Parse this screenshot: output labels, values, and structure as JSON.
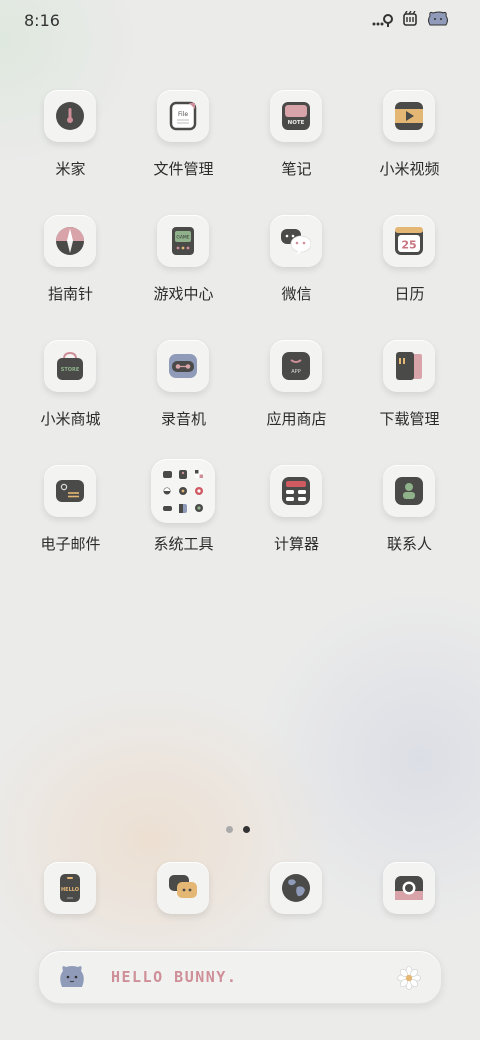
{
  "status_bar": {
    "time": "8:16",
    "icons": [
      "wifi-icon",
      "battery-icon",
      "bunny-icon"
    ]
  },
  "apps": [
    {
      "label": "米家",
      "icon": "thermometer-icon"
    },
    {
      "label": "文件管理",
      "icon": "file-icon",
      "icon_text": "File"
    },
    {
      "label": "笔记",
      "icon": "note-icon",
      "icon_text": "NOTE"
    },
    {
      "label": "小米视频",
      "icon": "video-play-icon"
    },
    {
      "label": "指南针",
      "icon": "compass-icon"
    },
    {
      "label": "游戏中心",
      "icon": "game-console-icon",
      "icon_text": "GAME"
    },
    {
      "label": "微信",
      "icon": "chat-bubble-icon"
    },
    {
      "label": "日历",
      "icon": "calendar-icon",
      "icon_text": "25"
    },
    {
      "label": "小米商城",
      "icon": "shopping-bag-icon",
      "icon_text": "STORE"
    },
    {
      "label": "录音机",
      "icon": "cassette-icon"
    },
    {
      "label": "应用商店",
      "icon": "app-store-icon",
      "icon_text": "APP"
    },
    {
      "label": "下载管理",
      "icon": "book-icon"
    },
    {
      "label": "电子邮件",
      "icon": "mail-icon"
    },
    {
      "label": "系统工具",
      "icon": "folder-icon"
    },
    {
      "label": "计算器",
      "icon": "calculator-icon"
    },
    {
      "label": "联系人",
      "icon": "contact-icon"
    }
  ],
  "dock": [
    {
      "icon": "phone-icon",
      "icon_text": "HELLO"
    },
    {
      "icon": "message-icon"
    },
    {
      "icon": "browser-globe-icon"
    },
    {
      "icon": "camera-icon"
    }
  ],
  "page_indicator": {
    "count": 2,
    "active": 2
  },
  "search": {
    "text": "HELLO BUNNY.",
    "icons": [
      "bunny-icon",
      "flower-icon"
    ]
  },
  "colors": {
    "accent_pink": "#cf8f98",
    "icon_dark": "#4a4a48",
    "icon_bg": "#f3f3f2"
  }
}
